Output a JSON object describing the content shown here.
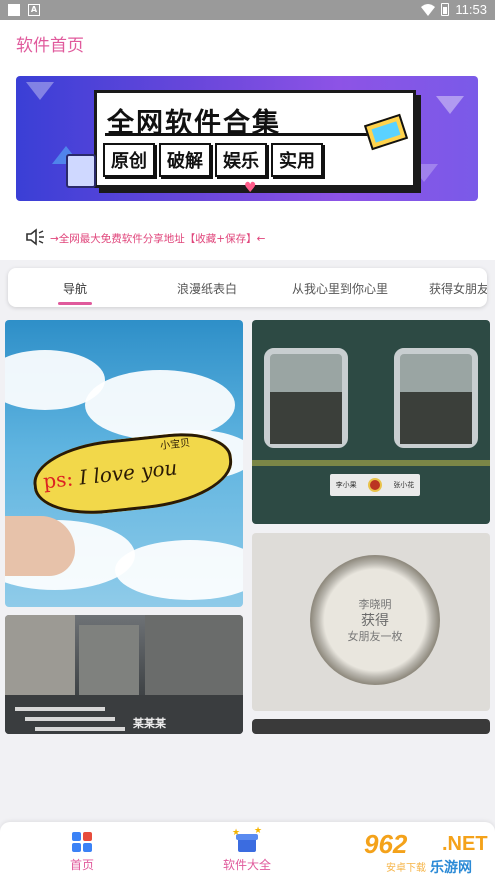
{
  "status_bar": {
    "time": "11:53",
    "a_label": "A"
  },
  "header": {
    "title": "软件首页"
  },
  "banner": {
    "title": "全网软件合集",
    "tags": [
      "原创",
      "破解",
      "娱乐",
      "实用"
    ]
  },
  "notice": {
    "text": "→全网最大免费软件分享地址【收藏+保存】←"
  },
  "tabs": {
    "items": [
      "导航",
      "浪漫纸表白",
      "从我心里到你心里",
      "获得女朋友"
    ],
    "active": "导航"
  },
  "photos": {
    "love_note_small": "小宝贝",
    "love_note_ps": "ps:",
    "love_note_main": "I love you",
    "train_plate_left": "李小果",
    "train_plate_right": "张小花",
    "bottlecap_line1": "李晓明",
    "bottlecap_line2": "获得",
    "bottlecap_line3": "女朋友一枚",
    "street_text": "某某某"
  },
  "bottom_nav": {
    "items": [
      {
        "label": "首页",
        "icon": "home-grid-icon"
      },
      {
        "label": "软件大全",
        "icon": "gift-box-icon"
      }
    ]
  },
  "watermark": {
    "num": "962",
    "net": ".NET",
    "cn": "乐游网",
    "cn_small": "安卓下载"
  },
  "colors": {
    "accent": "#e05a9c",
    "notice": "#e0457b",
    "nav_icon": "#3b82f6"
  }
}
